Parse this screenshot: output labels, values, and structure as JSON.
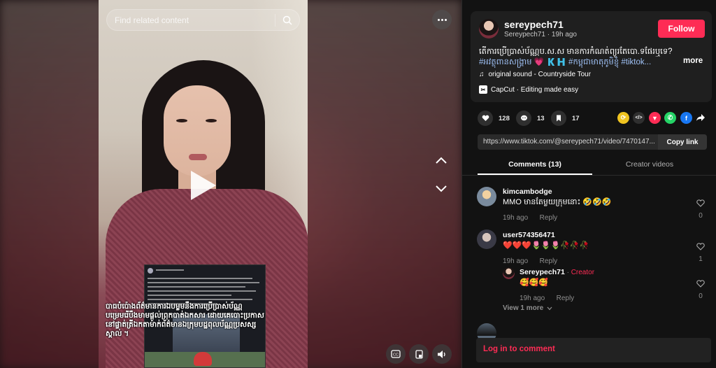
{
  "search": {
    "placeholder": "Find related content"
  },
  "video": {
    "caption": "បាធបំប៉ោងព័ត៌មានការឯបម្លមនឹងការប្រើប្រាស់ប័ណ្ណបម្រេមរើបឹងមាមផ្តល់ព្រុកបាត់ឯកសារ ដោយគេបោះប្រកាសនៅផ្ទាត់ត្រីឯកតាម៉ាក់ព័ត៌មានឯក្រុមបដ្ឋពុលប័ណ្ណប្រសស្ស ស្គាល់ ។"
  },
  "author": {
    "username": "sereypech71",
    "handle": "Sereypech71",
    "posted": "19h ago",
    "follow_label": "Follow"
  },
  "post": {
    "description": "តើការប្រើប្រាស់ប័ណ្ណប.ស.ស មានការកំណត់ព្យួរតែបោ.ទផែរឬទេ?",
    "hashtags": "#អវត្ថុពានសង្គ្រាម 💗 🇰🇭 #កម្ពុជាមាតុភូមិខ្ញុំ #tiktok...",
    "more_label": "more",
    "sound": "original sound - Countryside Tour",
    "capcut": "CapCut · Editing made easy"
  },
  "stats": {
    "likes": "128",
    "comments": "13",
    "saves": "17"
  },
  "share_colors": {
    "repost": "#f0c420",
    "embed": "#2f2f2f",
    "send": "#fe2c55",
    "whatsapp": "#25d366",
    "facebook": "#1877f2"
  },
  "link": {
    "url": "https://www.tiktok.com/@sereypech71/video/7470147...",
    "copy_label": "Copy link"
  },
  "tabs": {
    "comments": "Comments (13)",
    "creator": "Creator videos"
  },
  "comments": [
    {
      "user": "kimcambodge",
      "text": "MMO មានតែម្លយក្រុមនោះ 🤣🤣🤣",
      "time": "19h ago",
      "reply": "Reply",
      "likes": "0"
    },
    {
      "user": "user574356471",
      "text": "❤️❤️❤️🌷🌷🌷🥀🥀🥀",
      "time": "19h ago",
      "reply": "Reply",
      "likes": "1"
    }
  ],
  "reply": {
    "user": "Sereypech71",
    "sep": " · ",
    "tag": "Creator",
    "text": "🥰🥰🥰",
    "time": "19h ago",
    "reply": "Reply",
    "likes": "0"
  },
  "view_more": "View 1 more",
  "login": "Log in to comment"
}
